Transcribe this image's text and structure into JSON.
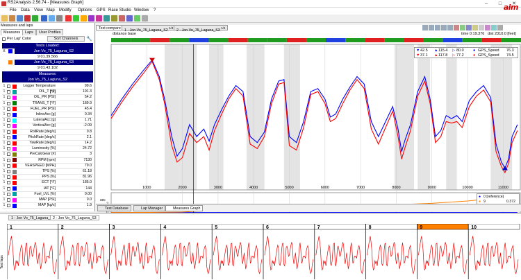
{
  "window": {
    "title": "RS2Analysis 2.56.74 - [Measures Graph]",
    "minimize": "–",
    "maximize": "□",
    "close": "✕"
  },
  "menu": [
    "File",
    "Data",
    "View",
    "Map",
    "Modify",
    "Options",
    "GPS",
    "Race Studio",
    "Window",
    "?"
  ],
  "logo": "aim",
  "left_panel": {
    "header": "Measures and laps",
    "tabs": [
      "Measures",
      "Laps",
      "User Profiles"
    ],
    "per_lap_color": "Per Lap' Color",
    "sort_button": "Sort Channels",
    "tests_loaded": "Tests Loaded:",
    "tests": [
      {
        "mark": "X",
        "name": "Jon Vo_75_Laguna_S2",
        "lap": "9  01.39.566",
        "color": "#0000ff"
      },
      {
        "mark": "",
        "name": "Jon Vo_75_Laguna_S3",
        "lap": "9  01.43.102",
        "color": "#ff8000"
      }
    ],
    "measures_header": "Measures:",
    "measures_test": "Jon Vo_75_Laguna_S2",
    "measures": [
      {
        "n": "1",
        "name": "Logger Temperature",
        "unit": "[°F]",
        "value": "99.6",
        "color": "#ff0000"
      },
      {
        "n": "1",
        "name": "OIL_T",
        "unit": "[°F]",
        "value": "191.3",
        "color": "#00a0a0"
      },
      {
        "n": "1",
        "name": "OIL_PR",
        "unit": "[PSI]",
        "value": "54.2",
        "color": "#ff00ff"
      },
      {
        "n": "1",
        "name": "TRANS_T",
        "unit": "[°F]",
        "value": "189.9",
        "color": "#008000"
      },
      {
        "n": "1",
        "name": "FUEL_PR",
        "unit": "[PSI]",
        "value": "45.4",
        "color": "#ff0000"
      },
      {
        "n": "1",
        "name": "InlineAcc",
        "unit": "[g]",
        "value": "0.34",
        "color": "#0000ff"
      },
      {
        "n": "1",
        "name": "LateralAcc",
        "unit": "[g]",
        "value": "1.71",
        "color": "#00ffff"
      },
      {
        "n": "1",
        "name": "VerticalAcc",
        "unit": "[g]",
        "value": "-2.09",
        "color": "#ff00ff"
      },
      {
        "n": "1",
        "name": "RollRate",
        "unit": "[deg/s]",
        "value": "0.8",
        "color": "#ff0000"
      },
      {
        "n": "1",
        "name": "PitchRate",
        "unit": "[deg/s]",
        "value": "2.1",
        "color": "#0000ff"
      },
      {
        "n": "1",
        "name": "YawRate",
        "unit": "[deg/s]",
        "value": "14.2",
        "color": "#ff0000"
      },
      {
        "n": "1",
        "name": "Luminosity",
        "unit": "[%]",
        "value": "24.72",
        "color": "#ff00ff"
      },
      {
        "n": "1",
        "name": "PreCalcGear",
        "unit": "[#]",
        "value": "3",
        "color": "#808000"
      },
      {
        "n": "1",
        "name": "RPM",
        "unit": "[rpm]",
        "value": "7130",
        "color": "#800000"
      },
      {
        "n": "1",
        "name": "VEHSPEED",
        "unit": "[MPH]",
        "value": "79.0",
        "color": "#ff0000"
      },
      {
        "n": "1",
        "name": "TPS",
        "unit": "[%]",
        "value": "61.18",
        "color": "#808080"
      },
      {
        "n": "1",
        "name": "PPS",
        "unit": "[%]",
        "value": "81.96",
        "color": "#ff0000"
      },
      {
        "n": "1",
        "name": "ECT",
        "unit": "[°F]",
        "value": "185.0",
        "color": "#ff0000"
      },
      {
        "n": "1",
        "name": "IAT",
        "unit": "[°F]",
        "value": "144",
        "color": "#0000ff"
      },
      {
        "n": "1",
        "name": "Fuel_LVL",
        "unit": "[%]",
        "value": "0.00",
        "color": "#00a0a0"
      },
      {
        "n": "1",
        "name": "MAP",
        "unit": "[PSI]",
        "value": "0.0",
        "color": "#ff00ff"
      },
      {
        "n": "1",
        "name": "MAP",
        "unit": "[kg/s]",
        "value": "1.9",
        "color": "#0000ff"
      }
    ]
  },
  "graph": {
    "tabs": [
      "Test compare",
      "1 - Jon Vo_75_Laguna_S2",
      "2 - Jon Vo_75_Laguna_S3"
    ],
    "tab_suffix": "1/4",
    "x_mode": "distance base",
    "time_readout": "time 0:19.376",
    "dist_readout": "dist 2310.0 [feet]",
    "legend_rows": [
      {
        "a": "42.5",
        "b": "115.4",
        "c": "80.0",
        "name": "GPS_Speed",
        "val": "76.3"
      },
      {
        "a": "37.1",
        "b": "117.8",
        "c": "77.2",
        "name": "GPS_Speed",
        "val": "74.5"
      }
    ],
    "sub_legend": {
      "ref_label": "0 [reference]",
      "cmp_label": "9",
      "cmp_value": "0.372"
    },
    "sub_ylabel": "sec",
    "sub_yticks": [
      "2",
      "0"
    ],
    "sub_value_9": "9"
  },
  "chart_data": {
    "type": "line",
    "xlabel": "",
    "ylabel": "",
    "x_ticks": [
      "1000",
      "2000",
      "3000",
      "4000",
      "5000",
      "6000",
      "7000",
      "8000",
      "9000",
      "10000",
      "11000"
    ],
    "xlim": [
      0,
      11500
    ],
    "series": [
      {
        "name": "GPS_Speed",
        "color": "#0000ff",
        "x": [
          0,
          300,
          600,
          900,
          1150,
          1350,
          1500,
          1700,
          1850,
          2000,
          2200,
          2400,
          2600,
          2750,
          2900,
          3100,
          3300,
          3500,
          3700,
          3900,
          4100,
          4300,
          4500,
          4700,
          4850,
          5000,
          5200,
          5400,
          5600,
          5800,
          6000,
          6150,
          6300,
          6500,
          6700,
          6900,
          7100,
          7300,
          7500,
          7700,
          7900,
          8050,
          8150,
          8250,
          8400,
          8600,
          8800,
          8950,
          9100,
          9250,
          9400,
          9550,
          9700,
          9850,
          10050,
          10250,
          10450,
          10650,
          10800,
          10950,
          11050,
          11150,
          11250,
          11400
        ],
        "y": [
          84,
          95,
          105,
          114,
          121,
          110,
          95,
          70,
          57,
          62,
          78,
          70,
          75,
          67,
          78,
          88,
          97,
          104,
          100,
          70,
          66,
          73,
          95,
          107,
          108,
          70,
          66,
          80,
          100,
          102,
          95,
          83,
          85,
          95,
          103,
          110,
          105,
          80,
          70,
          80,
          90,
          75,
          60,
          68,
          78,
          100,
          110,
          95,
          70,
          74,
          84,
          82,
          84,
          80,
          94,
          100,
          104,
          96,
          65,
          53,
          49,
          55,
          70,
          78
        ]
      },
      {
        "name": "GPS_Speed",
        "color": "#ff0000",
        "x": [
          0,
          300,
          600,
          900,
          1150,
          1350,
          1500,
          1700,
          1850,
          2000,
          2200,
          2400,
          2600,
          2750,
          2900,
          3100,
          3300,
          3500,
          3700,
          3900,
          4100,
          4300,
          4500,
          4700,
          4850,
          5000,
          5200,
          5400,
          5600,
          5800,
          6000,
          6150,
          6300,
          6500,
          6700,
          6900,
          7100,
          7300,
          7500,
          7700,
          7900,
          8050,
          8150,
          8250,
          8400,
          8600,
          8800,
          8950,
          9100,
          9250,
          9400,
          9550,
          9700,
          9850,
          10050,
          10250,
          10450,
          10650,
          10800,
          10950,
          11050,
          11150,
          11250,
          11400
        ],
        "y": [
          82,
          93,
          103,
          112,
          120,
          108,
          92,
          64,
          53,
          56,
          72,
          66,
          70,
          61,
          74,
          85,
          95,
          102,
          97,
          65,
          62,
          70,
          92,
          105,
          106,
          64,
          61,
          76,
          98,
          100,
          92,
          80,
          82,
          92,
          101,
          108,
          102,
          75,
          65,
          76,
          87,
          70,
          55,
          63,
          74,
          97,
          107,
          92,
          66,
          70,
          80,
          79,
          80,
          76,
          90,
          97,
          101,
          93,
          60,
          50,
          46,
          52,
          66,
          74
        ]
      },
      {
        "name": "0 [reference]",
        "color": "#0000ff",
        "x": [
          0,
          11400
        ],
        "y": [
          0,
          0
        ]
      },
      {
        "name": "9",
        "color": "#ff8000",
        "x": [
          0,
          1000,
          2000,
          2400,
          3000,
          4000,
          5000,
          6000,
          7000,
          8000,
          9000,
          10000,
          10500,
          11000,
          11400
        ],
        "y": [
          0,
          0.02,
          0.1,
          0.3,
          0.4,
          0.7,
          1.0,
          1.2,
          1.5,
          1.7,
          2.0,
          2.5,
          2.9,
          3.2,
          3.3
        ]
      }
    ]
  },
  "bottom_tabs": [
    "Test Database",
    "Lap Manager",
    "Measures Graph"
  ],
  "lower": {
    "tabs": [
      "1 - Jon Vo_75_Laguna_S2",
      "2 - Jon Vo_75_Laguna_S3"
    ],
    "side_label": "Test laps",
    "laps": [
      "1",
      "2",
      "3",
      "4",
      "5",
      "6",
      "7",
      "8",
      "9",
      "10"
    ],
    "selected_lap": "9"
  }
}
